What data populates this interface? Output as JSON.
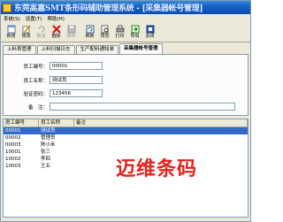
{
  "window": {
    "title": "东莞高嘉SMT条形码辅助管理系统 - [采集器帐号管理]"
  },
  "menu": {
    "items": [
      "系统(S)",
      "设置(T)",
      "帮助(H)"
    ]
  },
  "toolbar": {
    "buttons": [
      {
        "label": "新增",
        "icon": "new-icon",
        "enabled": true
      },
      {
        "label": "修改",
        "icon": "edit-icon",
        "enabled": true
      },
      {
        "label": "取消",
        "icon": "cancel-icon",
        "enabled": false
      },
      {
        "label": "删除",
        "icon": "delete-icon",
        "enabled": true
      },
      {
        "label": "保存",
        "icon": "save-icon",
        "enabled": false
      },
      {
        "label": "刷新",
        "icon": "refresh-icon",
        "enabled": true
      },
      {
        "label": "预览",
        "icon": "preview-icon",
        "enabled": true
      },
      {
        "label": "打印",
        "icon": "print-icon",
        "enabled": true
      },
      {
        "label": "导出",
        "icon": "export-icon",
        "enabled": true
      },
      {
        "label": "关闭",
        "icon": "close-icon",
        "enabled": true
      }
    ]
  },
  "tabs": [
    {
      "label": "上料表管理",
      "active": false
    },
    {
      "label": "上料扫描日志",
      "active": false
    },
    {
      "label": "生产配料通知单",
      "active": false
    },
    {
      "label": "采集器帐号管理",
      "active": true
    }
  ],
  "form": {
    "employee_id": {
      "label": "员工编号：",
      "value": "00001"
    },
    "employee_name": {
      "label": "员工名称：",
      "value": "测试员"
    },
    "password": {
      "label": "验证密码：",
      "value": "123456"
    },
    "remark": {
      "label": "备　注：",
      "value": ""
    }
  },
  "grid": {
    "columns": [
      "员工编号",
      "员工名称",
      "备注"
    ],
    "rows": [
      [
        "00001",
        "测试员",
        ""
      ],
      [
        "00002",
        "管理员",
        ""
      ],
      [
        "00003",
        "陈小禾",
        ""
      ],
      [
        "10001",
        "张三",
        ""
      ],
      [
        "10002",
        "李四",
        ""
      ],
      [
        "10003",
        "王五",
        ""
      ]
    ],
    "selected_index": 0
  },
  "watermark": "迈维条码"
}
